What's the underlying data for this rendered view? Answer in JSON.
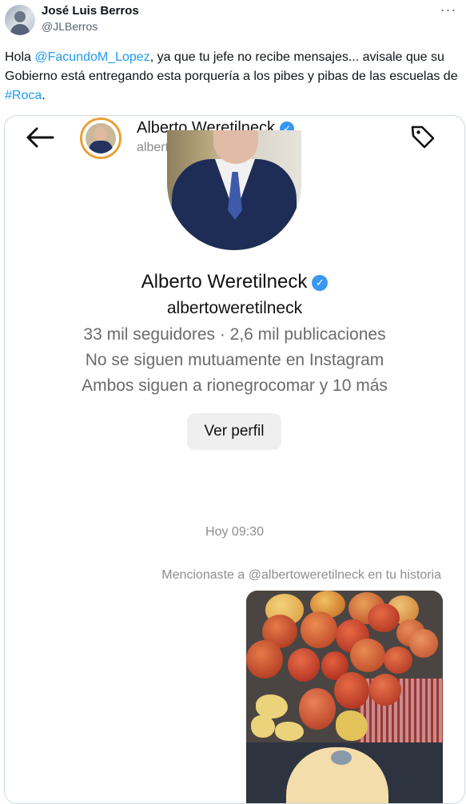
{
  "tweet": {
    "author_name": "José Luis Berros",
    "author_handle": "@JLBerros",
    "text_1": "Hola ",
    "mention": "@FacundoM_Lopez",
    "text_2": ", ya que tu jefe no recibe mensajes... avisale que su Gobierno está entregando esta porquería a los pibes y pibas de las escuelas de ",
    "hashtag": "#Roca",
    "text_3": "."
  },
  "instagram": {
    "header_name": "Alberto Weretilneck",
    "header_handle": "albertoweretilneck",
    "profile_name": "Alberto Weretilneck",
    "profile_handle": "albertoweretilneck",
    "stats": "33 mil seguidores · 2,6 mil publicaciones",
    "follow_status": "No se siguen mutuamente en Instagram",
    "mutual": "Ambos siguen a rionegrocomar y 10 más",
    "view_profile_label": "Ver perfil",
    "timestamp": "Hoy 09:30",
    "mention_note": "Mencionaste a @albertoweretilneck en tu historia"
  },
  "icons": {
    "more": "more-icon",
    "back": "back-arrow-icon",
    "tag": "tag-icon",
    "verified": "verified-icon"
  },
  "colors": {
    "link": "#1d9bf0",
    "verified": "#3897f0"
  }
}
